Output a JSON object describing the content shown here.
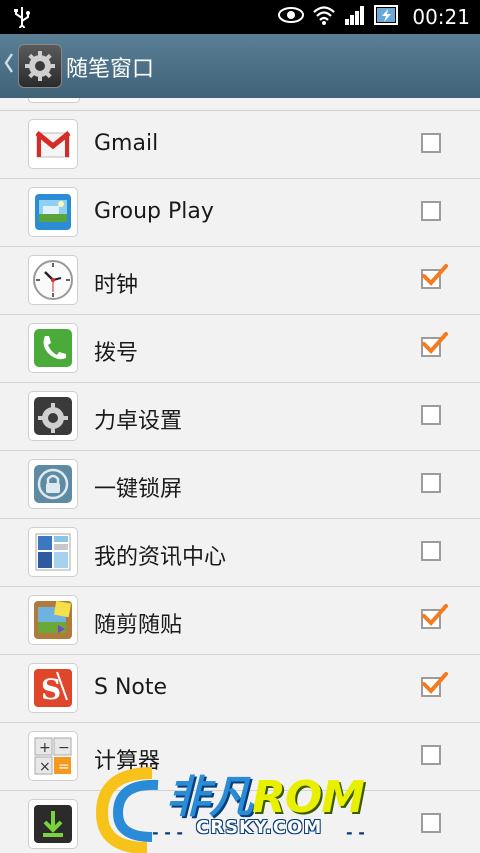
{
  "status_bar": {
    "time": "00:21",
    "icons": [
      "usb-icon",
      "eye-icon",
      "wifi-icon",
      "signal-icon",
      "battery-charging-icon"
    ]
  },
  "action_bar": {
    "title": "随笔窗口",
    "back_icon": "back-chevron-icon",
    "app_icon": "settings-gear-icon"
  },
  "apps": [
    {
      "label": "Gmail",
      "checked": false,
      "icon": "gmail-icon"
    },
    {
      "label": "Group Play",
      "checked": false,
      "icon": "group-play-icon"
    },
    {
      "label": "时钟",
      "checked": true,
      "icon": "clock-icon"
    },
    {
      "label": "拨号",
      "checked": true,
      "icon": "phone-icon"
    },
    {
      "label": "力卓设置",
      "checked": false,
      "icon": "settings-gear-icon"
    },
    {
      "label": "一键锁屏",
      "checked": false,
      "icon": "lock-icon"
    },
    {
      "label": "我的资讯中心",
      "checked": false,
      "icon": "news-icon"
    },
    {
      "label": "随剪随贴",
      "checked": true,
      "icon": "scrapbook-icon"
    },
    {
      "label": "S Note",
      "checked": true,
      "icon": "s-note-icon"
    },
    {
      "label": "计算器",
      "checked": false,
      "icon": "calculator-icon"
    },
    {
      "label": "",
      "checked": false,
      "icon": "download-icon"
    }
  ],
  "watermark": {
    "brand": "非凡",
    "brand_rom": "ROM",
    "url": "CRSKY.COM"
  },
  "colors": {
    "accent_check": "#f47b20",
    "action_bar": "#4a6e84"
  }
}
